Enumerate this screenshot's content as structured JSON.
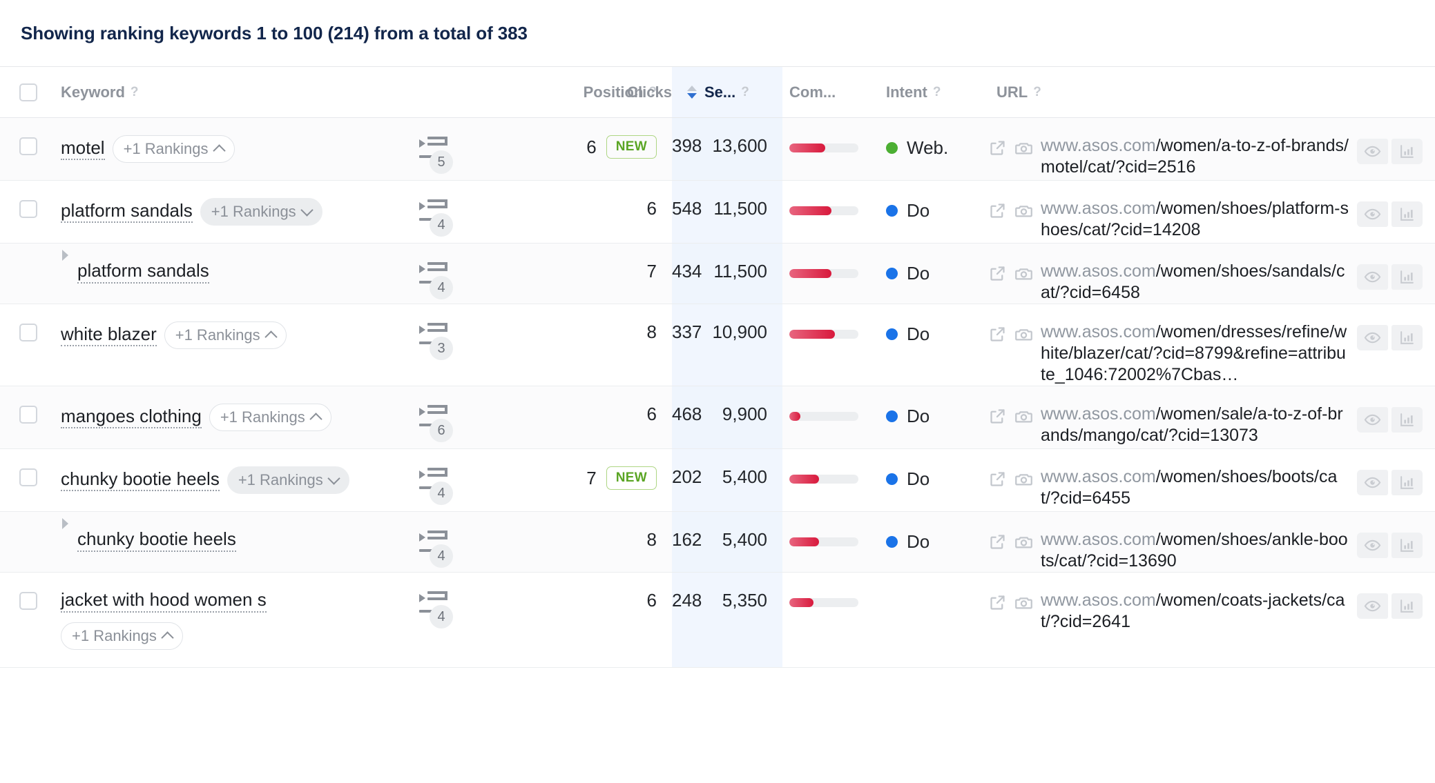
{
  "summary": {
    "text": "Showing ranking keywords 1 to 100 (214) from a total of 383",
    "range_start": "1",
    "range_end": "100",
    "shown_count": "214",
    "total": "383"
  },
  "colors": {
    "accent_blue": "#2f6fd0",
    "title_navy": "#12264b",
    "intent_do": "#1a73e8",
    "intent_web": "#4caf33",
    "comp_bar_start": "#e8657f",
    "comp_bar_end": "#d8193c",
    "new_badge_text": "#5aa524",
    "new_badge_border": "#aed684",
    "sorted_col_bg": "#f1f6fe"
  },
  "table": {
    "select_all_label": "select-all",
    "columns": [
      {
        "key": "checkbox",
        "label": "",
        "help": false,
        "align": "left"
      },
      {
        "key": "keyword",
        "label": "Keyword",
        "help": true,
        "align": "left"
      },
      {
        "key": "serp",
        "label": "",
        "help": false,
        "align": "center"
      },
      {
        "key": "position",
        "label": "Position",
        "help": true,
        "align": "right"
      },
      {
        "key": "clicks",
        "label": "Clicks",
        "help": false,
        "align": "right"
      },
      {
        "key": "searches",
        "label": "Se...",
        "help": true,
        "align": "right",
        "sorted": true,
        "sort_dir": "desc"
      },
      {
        "key": "competition",
        "label": "Com...",
        "help": false,
        "align": "left"
      },
      {
        "key": "intent",
        "label": "Intent",
        "help": true,
        "align": "left"
      },
      {
        "key": "url",
        "label": "URL",
        "help": true,
        "align": "left"
      },
      {
        "key": "actions",
        "label": "",
        "help": false,
        "align": "left"
      }
    ],
    "help_glyph": "?",
    "rows": [
      {
        "keyword": "motel",
        "sub": false,
        "checkbox": true,
        "rankings_badge": {
          "label": "+1 Rankings",
          "style": "outlined",
          "chevron": "up"
        },
        "badge_wraps": false,
        "serp_count": "5",
        "position": "6",
        "is_new": true,
        "new_label": "NEW",
        "clicks": "398",
        "searches": "13,600",
        "competition_pct": 52,
        "intent": "Web.",
        "intent_color": "#4caf33",
        "url_domain": "www.asos.com",
        "url_path": "/women/a-to-z-of-brands/motel/cat/?cid=2516"
      },
      {
        "keyword": "platform sandals",
        "sub": false,
        "checkbox": true,
        "rankings_badge": {
          "label": "+1 Rankings",
          "style": "filled",
          "chevron": "down"
        },
        "badge_wraps": false,
        "serp_count": "4",
        "position": "6",
        "is_new": false,
        "new_label": "",
        "clicks": "548",
        "searches": "11,500",
        "competition_pct": 61,
        "intent": "Do",
        "intent_color": "#1a73e8",
        "url_domain": "www.asos.com",
        "url_path": "/women/shoes/platform-shoes/cat/?cid=14208"
      },
      {
        "keyword": "platform sandals",
        "sub": true,
        "checkbox": false,
        "rankings_badge": null,
        "badge_wraps": false,
        "serp_count": "4",
        "position": "7",
        "is_new": false,
        "new_label": "",
        "clicks": "434",
        "searches": "11,500",
        "competition_pct": 61,
        "intent": "Do",
        "intent_color": "#1a73e8",
        "url_domain": "www.asos.com",
        "url_path": "/women/shoes/sandals/cat/?cid=6458"
      },
      {
        "keyword": "white blazer",
        "sub": false,
        "checkbox": true,
        "rankings_badge": {
          "label": "+1 Rankings",
          "style": "outlined",
          "chevron": "up"
        },
        "badge_wraps": false,
        "serp_count": "3",
        "position": "8",
        "is_new": false,
        "new_label": "",
        "clicks": "337",
        "searches": "10,900",
        "competition_pct": 66,
        "intent": "Do",
        "intent_color": "#1a73e8",
        "url_domain": "www.asos.com",
        "url_path": "/women/dresses/refine/white/blazer/cat/?cid=8799&refine=attribute_1046:72002%7Cbas…"
      },
      {
        "keyword": "mangoes clothing",
        "sub": false,
        "checkbox": true,
        "rankings_badge": {
          "label": "+1 Rankings",
          "style": "outlined",
          "chevron": "up"
        },
        "badge_wraps": false,
        "serp_count": "6",
        "position": "6",
        "is_new": false,
        "new_label": "",
        "clicks": "468",
        "searches": "9,900",
        "competition_pct": 16,
        "intent": "Do",
        "intent_color": "#1a73e8",
        "url_domain": "www.asos.com",
        "url_path": "/women/sale/a-to-z-of-brands/mango/cat/?cid=13073"
      },
      {
        "keyword": "chunky bootie heels",
        "sub": false,
        "checkbox": true,
        "rankings_badge": {
          "label": "+1 Rankings",
          "style": "filled",
          "chevron": "down"
        },
        "badge_wraps": false,
        "serp_count": "4",
        "position": "7",
        "is_new": true,
        "new_label": "NEW",
        "clicks": "202",
        "searches": "5,400",
        "competition_pct": 43,
        "intent": "Do",
        "intent_color": "#1a73e8",
        "url_domain": "www.asos.com",
        "url_path": "/women/shoes/boots/cat/?cid=6455"
      },
      {
        "keyword": "chunky bootie heels",
        "sub": true,
        "checkbox": false,
        "rankings_badge": null,
        "badge_wraps": false,
        "serp_count": "4",
        "position": "8",
        "is_new": false,
        "new_label": "",
        "clicks": "162",
        "searches": "5,400",
        "competition_pct": 43,
        "intent": "Do",
        "intent_color": "#1a73e8",
        "url_domain": "www.asos.com",
        "url_path": "/women/shoes/ankle-boots/cat/?cid=13690"
      },
      {
        "keyword": "jacket with hood women s",
        "sub": false,
        "checkbox": true,
        "rankings_badge": {
          "label": "+1 Rankings",
          "style": "outlined",
          "chevron": "up"
        },
        "badge_wraps": true,
        "serp_count": "4",
        "position": "6",
        "is_new": false,
        "new_label": "",
        "clicks": "248",
        "searches": "5,350",
        "competition_pct": 35,
        "intent": "",
        "intent_color": "",
        "url_domain": "www.asos.com",
        "url_path": "/women/coats-jackets/cat/?cid=2641"
      }
    ],
    "actions": {
      "preview_label": "eye-icon",
      "chart_label": "bar-chart-icon"
    }
  }
}
